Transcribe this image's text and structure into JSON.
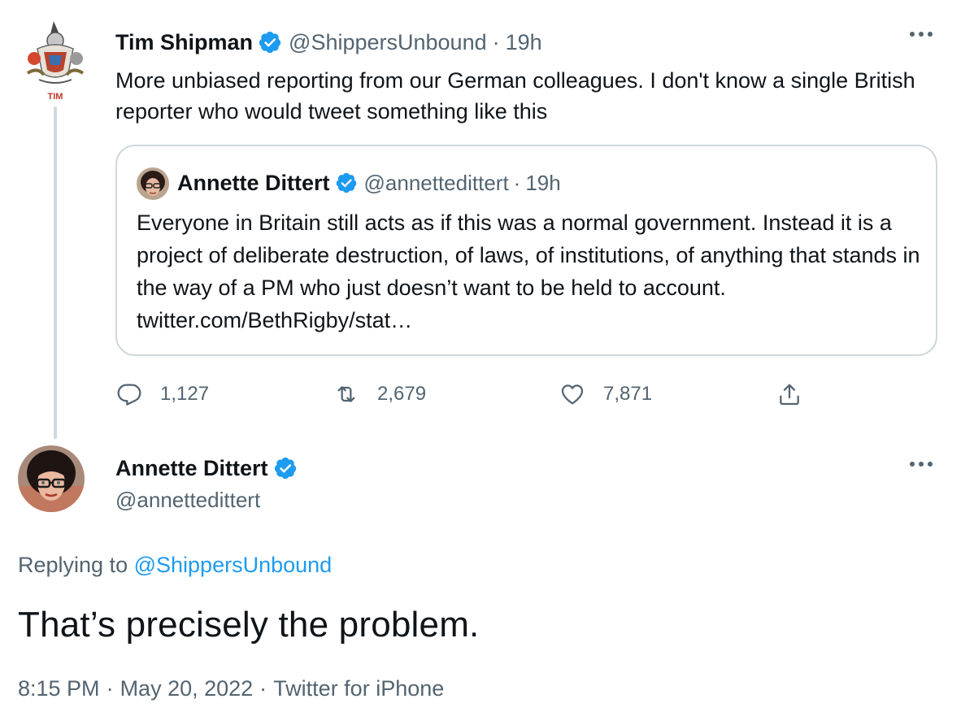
{
  "parent_tweet": {
    "avatar_label": "TIM",
    "author_name": "Tim Shipman",
    "handle": "@ShippersUnbound",
    "separator": "·",
    "time": "19h",
    "more_icon": "more-horizontal-icon",
    "text": "More unbiased reporting from our German colleagues. I don't know a single British reporter who would tweet something like this",
    "quoted_tweet": {
      "author_name": "Annette Dittert",
      "handle": "@annettedittert",
      "separator": "·",
      "time": "19h",
      "text": "Everyone in Britain still acts as if this was a normal government. Instead it is a project of deliberate destruction, of laws, of institutions, of anything that stands in the way of a PM who just doesn’t want to be held to account. twitter.com/BethRigby/stat…"
    },
    "actions": {
      "reply_count": "1,127",
      "retweet_count": "2,679",
      "like_count": "7,871"
    }
  },
  "reply_tweet": {
    "author_name": "Annette Dittert",
    "handle": "@annettedittert",
    "replying_prefix": "Replying to",
    "replying_to": "@ShippersUnbound",
    "text": "That’s precisely the problem.",
    "time": "8:15 PM",
    "date": "May 20, 2022",
    "source": "Twitter for iPhone",
    "separator": "·"
  },
  "colors": {
    "text_primary": "#0f1419",
    "text_secondary": "#536471",
    "accent": "#1d9bf0",
    "border": "#cfd9de"
  },
  "icons": [
    "verified-badge-icon",
    "reply-icon",
    "retweet-icon",
    "like-icon",
    "share-icon",
    "more-horizontal-icon"
  ]
}
